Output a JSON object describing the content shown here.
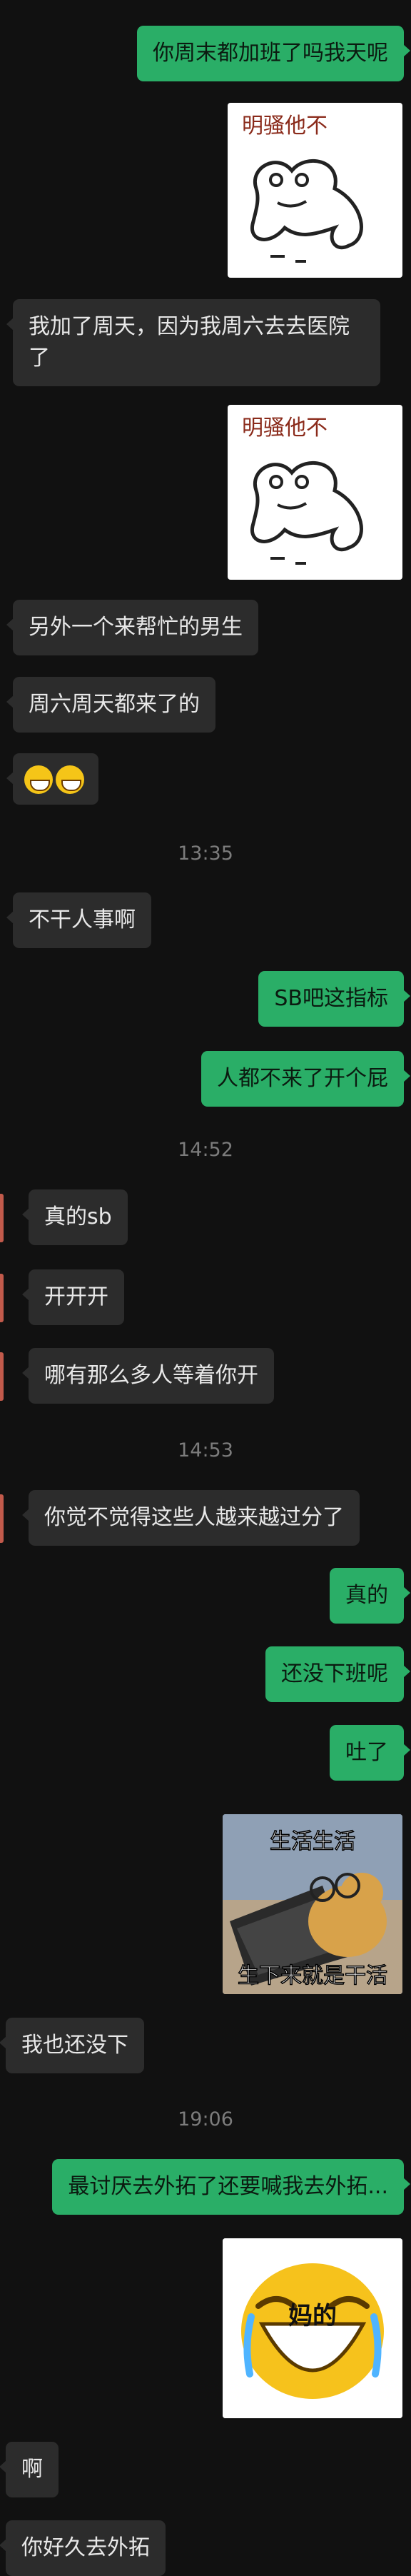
{
  "messages": [
    {
      "dir": "out",
      "text": "你周末都加班了吗我天呢"
    },
    {
      "dir": "in",
      "text": "我加了周天，因为我周六去去医院了"
    },
    {
      "dir": "in",
      "text": "另外一个来帮忙的男生"
    },
    {
      "dir": "in",
      "text": "周六周天都来了的"
    },
    {
      "dir": "in",
      "emoji": "grinning-face"
    },
    {
      "ts": "13:35"
    },
    {
      "dir": "in",
      "text": "不干人事啊"
    },
    {
      "dir": "out",
      "text": "SB吧这指标"
    },
    {
      "dir": "out",
      "text": "人都不来了开个屁"
    },
    {
      "ts": "14:52"
    },
    {
      "dir": "in",
      "text": "真的sb"
    },
    {
      "dir": "in",
      "text": "开开开"
    },
    {
      "dir": "in",
      "text": "哪有那么多人等着你开"
    },
    {
      "ts": "14:53"
    },
    {
      "dir": "in",
      "text": "你觉不觉得这些人越来越过分了"
    },
    {
      "dir": "out",
      "text": "真的"
    },
    {
      "dir": "out",
      "text": "还没下班呢"
    },
    {
      "dir": "out",
      "text": "吐了"
    },
    {
      "dir": "in",
      "text": "我也还没下"
    },
    {
      "ts": "19:06"
    },
    {
      "dir": "out",
      "text": "最讨厌去外拓了还要喊我去外拓..."
    },
    {
      "dir": "in",
      "text": "啊"
    },
    {
      "dir": "in",
      "text": "你好久去外拓"
    }
  ],
  "stickers": {
    "frog_caption": "明骚他不",
    "dog_top": "生活生活",
    "dog_bottom": "生下来就是干活",
    "laugh_caption": "妈的"
  },
  "colors": {
    "background": "#111111",
    "outgoing_bubble": "#2aae67",
    "incoming_bubble": "#2c2c2c",
    "timestamp": "#7c7c7c"
  }
}
